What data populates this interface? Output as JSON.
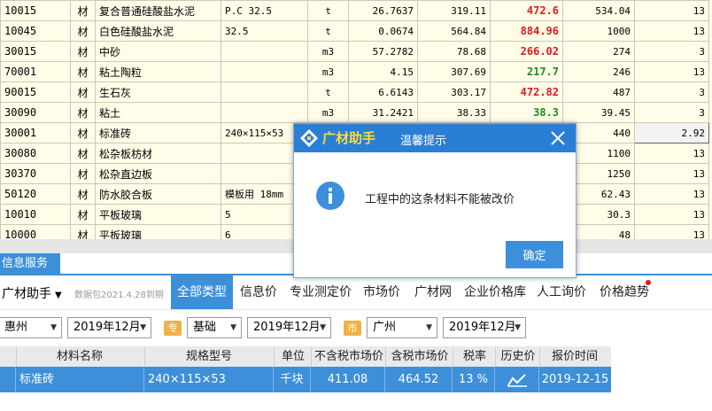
{
  "grid": {
    "rows": [
      {
        "code": "10015",
        "type": "材",
        "name": "复合普通硅酸盐水泥",
        "spec": "P.C 32.5",
        "unit": "t",
        "qty": "26.7637",
        "p1": "319.11",
        "p2": "472.6",
        "p2_color": "#e0191f",
        "p3": "534.04",
        "tax": "13"
      },
      {
        "code": "10045",
        "type": "材",
        "name": "白色硅酸盐水泥",
        "spec": "32.5",
        "unit": "t",
        "qty": "0.0674",
        "p1": "564.84",
        "p2": "884.96",
        "p2_color": "#e0191f",
        "p3": "1000",
        "tax": "13"
      },
      {
        "code": "30015",
        "type": "材",
        "name": "中砂",
        "spec": "",
        "unit": "m3",
        "qty": "57.2782",
        "p1": "78.68",
        "p2": "266.02",
        "p2_color": "#e0191f",
        "p3": "274",
        "tax": "3"
      },
      {
        "code": "70001",
        "type": "材",
        "name": "粘土陶粒",
        "spec": "",
        "unit": "m3",
        "qty": "4.15",
        "p1": "307.69",
        "p2": "217.7",
        "p2_color": "#1a8f1a",
        "p3": "246",
        "tax": "13"
      },
      {
        "code": "90015",
        "type": "材",
        "name": "生石灰",
        "spec": "",
        "unit": "t",
        "qty": "6.6143",
        "p1": "303.17",
        "p2": "472.82",
        "p2_color": "#e0191f",
        "p3": "487",
        "tax": "3"
      },
      {
        "code": "30090",
        "type": "材",
        "name": "粘土",
        "spec": "",
        "unit": "m3",
        "qty": "31.2421",
        "p1": "38.33",
        "p2": "38.3",
        "p2_color": "#1a8f1a",
        "p3": "39.45",
        "tax": "3"
      },
      {
        "code": "30001",
        "type": "材",
        "name": "标准砖",
        "spec": "240×115×53",
        "unit": "",
        "qty": "",
        "p1": "",
        "p2": "",
        "p2_color": "#e0191f",
        "p3": "440",
        "tax": "2.92"
      },
      {
        "code": "30080",
        "type": "材",
        "name": "松杂板枋材",
        "spec": "",
        "unit": "",
        "qty": "",
        "p1": "",
        "p2": "",
        "p2_color": "#e0191f",
        "p3": "1100",
        "tax": "13"
      },
      {
        "code": "30370",
        "type": "材",
        "name": "松杂直边板",
        "spec": "",
        "unit": "",
        "qty": "",
        "p1": "",
        "p2": "",
        "p2_color": "#e0191f",
        "p3": "1250",
        "tax": "13"
      },
      {
        "code": "50120",
        "type": "材",
        "name": "防水胶合板",
        "spec": "模板用 18mm",
        "unit": "",
        "qty": "",
        "p1": "",
        "p2": "",
        "p2_color": "#e0191f",
        "p3": "62.43",
        "tax": "13"
      },
      {
        "code": "10010",
        "type": "材",
        "name": "平板玻璃",
        "spec": "5",
        "unit": "",
        "qty": "",
        "p1": "",
        "p2": "",
        "p2_color": "#e0191f",
        "p3": "30.3",
        "tax": "13"
      },
      {
        "code": "10000",
        "type": "材",
        "name": "平板玻璃",
        "spec": "6",
        "unit": "",
        "qty": "",
        "p1": "",
        "p2": "",
        "p2_color": "#e0191f",
        "p3": "48",
        "tax": "13"
      }
    ]
  },
  "panel": {
    "tab_label": "信息服务",
    "brand": "广材助手",
    "package_note": "数据包2021.4.28到期",
    "nav_tabs": [
      "全部类型",
      "信息价",
      "专业测定价",
      "市场价",
      "广材网",
      "企业价格库",
      "人工询价",
      "价格趋势"
    ],
    "filters": {
      "region": "惠州",
      "period1": "2019年12月",
      "tag1": "专",
      "category": "基础",
      "period2": "2019年12月",
      "tag2": "市",
      "city": "广州",
      "period3": "2019年12月"
    },
    "table_headers": [
      "材料名称",
      "规格型号",
      "单位",
      "不含税市场价",
      "含税市场价",
      "税率",
      "历史价",
      "报价时间"
    ],
    "table_row": {
      "name": "标准砖",
      "spec": "240×115×53",
      "unit": "千块",
      "price_ex_tax": "411.08",
      "price_inc_tax": "464.52",
      "tax_rate": "13 %",
      "time": "2019-12-15"
    }
  },
  "dialog": {
    "brand": "广材助手",
    "title": "温馨提示",
    "message": "工程中的这条材料不能被改价",
    "ok_label": "确定"
  },
  "colors": {
    "accent": "#3d8fd9",
    "price_up": "#e0191f",
    "price_down": "#1a8f1a",
    "grid_bg": "#fffde8"
  },
  "icons": [
    "close-icon",
    "info-icon",
    "logo-icon",
    "chevron-down-icon",
    "trend-chart-icon"
  ]
}
